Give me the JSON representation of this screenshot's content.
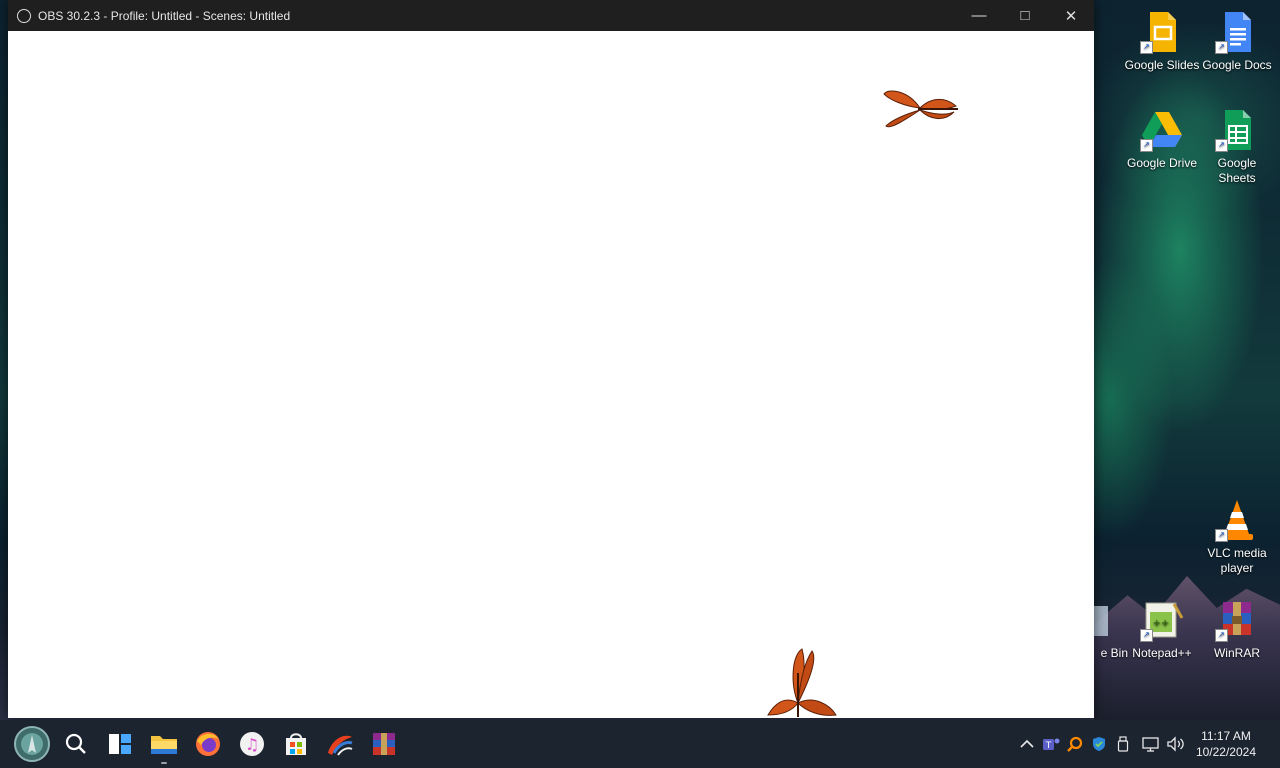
{
  "window": {
    "title": "OBS 30.2.3 - Profile: Untitled - Scenes: Untitled",
    "minimize_glyph": "—",
    "maximize_glyph": "□",
    "close_glyph": "✕"
  },
  "desktop_icons": [
    {
      "label": "Google Slides",
      "icon": "google-slides-icon"
    },
    {
      "label": "Google Docs",
      "icon": "google-docs-icon"
    },
    {
      "label": "Google Drive",
      "icon": "google-drive-icon"
    },
    {
      "label": "Google Sheets",
      "icon": "google-sheets-icon"
    },
    {
      "label": "VLC media player",
      "icon": "vlc-icon"
    },
    {
      "label": "Notepad++",
      "icon": "notepadpp-icon"
    },
    {
      "label": "WinRAR",
      "icon": "winrar-icon"
    },
    {
      "label": "e Bin",
      "icon": "recycle-bin-icon"
    }
  ],
  "taskbar": {
    "apps": [
      "start-icon",
      "search-icon",
      "task-view-icon",
      "file-explorer-icon",
      "firefox-icon",
      "itunes-icon",
      "microsoft-store-icon",
      "app-icon",
      "winrar-icon"
    ],
    "tray": [
      "chevron-up-icon",
      "teams-icon",
      "search-tool-icon",
      "defender-icon",
      "usb-icon",
      "network-icon",
      "volume-icon"
    ],
    "time": "11:17 AM",
    "date": "10/22/2024"
  },
  "colors": {
    "taskbar_bg": "#1c2430",
    "titlebar_bg": "#1f1f1f",
    "butterfly": "#d2551a"
  }
}
